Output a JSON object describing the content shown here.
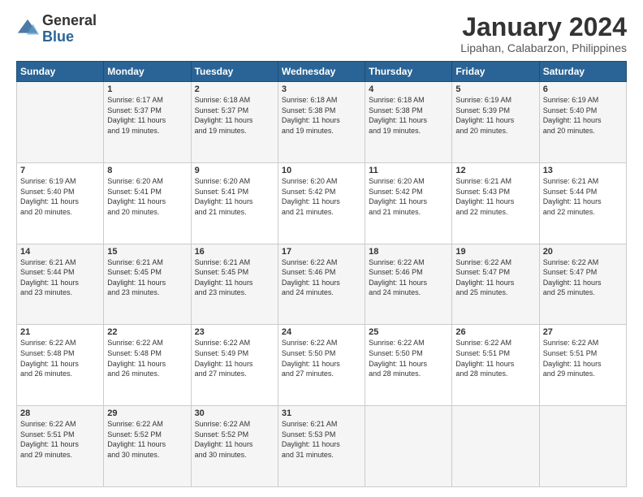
{
  "header": {
    "logo": {
      "general": "General",
      "blue": "Blue"
    },
    "title": "January 2024",
    "subtitle": "Lipahan, Calabarzon, Philippines"
  },
  "calendar": {
    "days_of_week": [
      "Sunday",
      "Monday",
      "Tuesday",
      "Wednesday",
      "Thursday",
      "Friday",
      "Saturday"
    ],
    "weeks": [
      [
        {
          "num": "",
          "data": ""
        },
        {
          "num": "1",
          "data": "Sunrise: 6:17 AM\nSunset: 5:37 PM\nDaylight: 11 hours\nand 19 minutes."
        },
        {
          "num": "2",
          "data": "Sunrise: 6:18 AM\nSunset: 5:37 PM\nDaylight: 11 hours\nand 19 minutes."
        },
        {
          "num": "3",
          "data": "Sunrise: 6:18 AM\nSunset: 5:38 PM\nDaylight: 11 hours\nand 19 minutes."
        },
        {
          "num": "4",
          "data": "Sunrise: 6:18 AM\nSunset: 5:38 PM\nDaylight: 11 hours\nand 19 minutes."
        },
        {
          "num": "5",
          "data": "Sunrise: 6:19 AM\nSunset: 5:39 PM\nDaylight: 11 hours\nand 20 minutes."
        },
        {
          "num": "6",
          "data": "Sunrise: 6:19 AM\nSunset: 5:40 PM\nDaylight: 11 hours\nand 20 minutes."
        }
      ],
      [
        {
          "num": "7",
          "data": "Sunrise: 6:19 AM\nSunset: 5:40 PM\nDaylight: 11 hours\nand 20 minutes."
        },
        {
          "num": "8",
          "data": "Sunrise: 6:20 AM\nSunset: 5:41 PM\nDaylight: 11 hours\nand 20 minutes."
        },
        {
          "num": "9",
          "data": "Sunrise: 6:20 AM\nSunset: 5:41 PM\nDaylight: 11 hours\nand 21 minutes."
        },
        {
          "num": "10",
          "data": "Sunrise: 6:20 AM\nSunset: 5:42 PM\nDaylight: 11 hours\nand 21 minutes."
        },
        {
          "num": "11",
          "data": "Sunrise: 6:20 AM\nSunset: 5:42 PM\nDaylight: 11 hours\nand 21 minutes."
        },
        {
          "num": "12",
          "data": "Sunrise: 6:21 AM\nSunset: 5:43 PM\nDaylight: 11 hours\nand 22 minutes."
        },
        {
          "num": "13",
          "data": "Sunrise: 6:21 AM\nSunset: 5:44 PM\nDaylight: 11 hours\nand 22 minutes."
        }
      ],
      [
        {
          "num": "14",
          "data": "Sunrise: 6:21 AM\nSunset: 5:44 PM\nDaylight: 11 hours\nand 23 minutes."
        },
        {
          "num": "15",
          "data": "Sunrise: 6:21 AM\nSunset: 5:45 PM\nDaylight: 11 hours\nand 23 minutes."
        },
        {
          "num": "16",
          "data": "Sunrise: 6:21 AM\nSunset: 5:45 PM\nDaylight: 11 hours\nand 23 minutes."
        },
        {
          "num": "17",
          "data": "Sunrise: 6:22 AM\nSunset: 5:46 PM\nDaylight: 11 hours\nand 24 minutes."
        },
        {
          "num": "18",
          "data": "Sunrise: 6:22 AM\nSunset: 5:46 PM\nDaylight: 11 hours\nand 24 minutes."
        },
        {
          "num": "19",
          "data": "Sunrise: 6:22 AM\nSunset: 5:47 PM\nDaylight: 11 hours\nand 25 minutes."
        },
        {
          "num": "20",
          "data": "Sunrise: 6:22 AM\nSunset: 5:47 PM\nDaylight: 11 hours\nand 25 minutes."
        }
      ],
      [
        {
          "num": "21",
          "data": "Sunrise: 6:22 AM\nSunset: 5:48 PM\nDaylight: 11 hours\nand 26 minutes."
        },
        {
          "num": "22",
          "data": "Sunrise: 6:22 AM\nSunset: 5:48 PM\nDaylight: 11 hours\nand 26 minutes."
        },
        {
          "num": "23",
          "data": "Sunrise: 6:22 AM\nSunset: 5:49 PM\nDaylight: 11 hours\nand 27 minutes."
        },
        {
          "num": "24",
          "data": "Sunrise: 6:22 AM\nSunset: 5:50 PM\nDaylight: 11 hours\nand 27 minutes."
        },
        {
          "num": "25",
          "data": "Sunrise: 6:22 AM\nSunset: 5:50 PM\nDaylight: 11 hours\nand 28 minutes."
        },
        {
          "num": "26",
          "data": "Sunrise: 6:22 AM\nSunset: 5:51 PM\nDaylight: 11 hours\nand 28 minutes."
        },
        {
          "num": "27",
          "data": "Sunrise: 6:22 AM\nSunset: 5:51 PM\nDaylight: 11 hours\nand 29 minutes."
        }
      ],
      [
        {
          "num": "28",
          "data": "Sunrise: 6:22 AM\nSunset: 5:51 PM\nDaylight: 11 hours\nand 29 minutes."
        },
        {
          "num": "29",
          "data": "Sunrise: 6:22 AM\nSunset: 5:52 PM\nDaylight: 11 hours\nand 30 minutes."
        },
        {
          "num": "30",
          "data": "Sunrise: 6:22 AM\nSunset: 5:52 PM\nDaylight: 11 hours\nand 30 minutes."
        },
        {
          "num": "31",
          "data": "Sunrise: 6:21 AM\nSunset: 5:53 PM\nDaylight: 11 hours\nand 31 minutes."
        },
        {
          "num": "",
          "data": ""
        },
        {
          "num": "",
          "data": ""
        },
        {
          "num": "",
          "data": ""
        }
      ]
    ]
  }
}
